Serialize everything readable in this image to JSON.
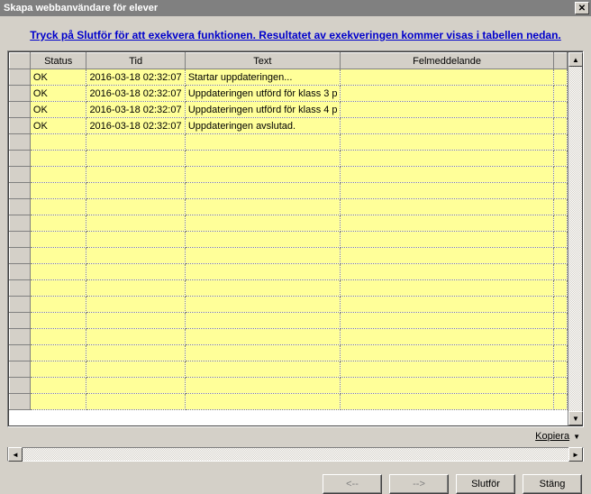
{
  "window": {
    "title": "Skapa webbanvändare för elever",
    "close_glyph": "✕"
  },
  "instruction": "Tryck på Slutför för att exekvera funktionen. Resultatet av exekveringen kommer visas i tabellen nedan.",
  "columns": {
    "status": "Status",
    "tid": "Tid",
    "text": "Text",
    "fel": "Felmeddelande"
  },
  "rows": [
    {
      "status": "OK",
      "tid": "2016-03-18 02:32:07",
      "text": "Startar uppdateringen...",
      "fel": ""
    },
    {
      "status": "OK",
      "tid": "2016-03-18 02:32:07",
      "text": "Uppdateringen utförd för klass 3 p",
      "fel": ""
    },
    {
      "status": "OK",
      "tid": "2016-03-18 02:32:07",
      "text": "Uppdateringen utförd för klass 4 p",
      "fel": ""
    },
    {
      "status": "OK",
      "tid": "2016-03-18 02:32:07",
      "text": "Uppdateringen avslutad.",
      "fel": ""
    }
  ],
  "empty_row_count": 17,
  "copy_label": "Kopiera",
  "buttons": {
    "back": "<--",
    "next": "-->",
    "finish": "Slutför",
    "close": "Stäng"
  },
  "glyphs": {
    "up": "▲",
    "down": "▼",
    "left": "◄",
    "right": "►"
  }
}
